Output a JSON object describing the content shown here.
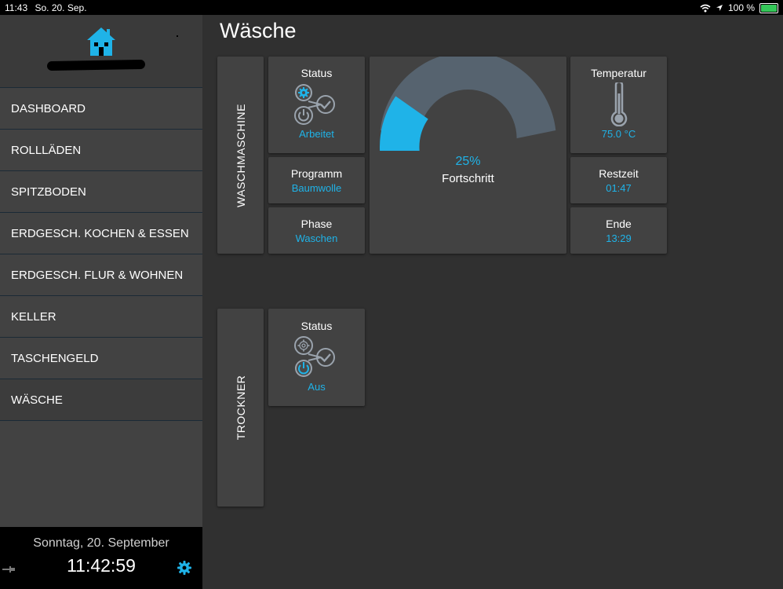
{
  "statusbar": {
    "time": "11:43",
    "date": "So. 20. Sep.",
    "battery": "100 %"
  },
  "sidebar": {
    "items": [
      {
        "label": "DASHBOARD"
      },
      {
        "label": "ROLLLÄDEN"
      },
      {
        "label": "SPITZBODEN"
      },
      {
        "label": "ERDGESCH. KOCHEN & ESSEN"
      },
      {
        "label": "ERDGESCH. FLUR & WOHNEN"
      },
      {
        "label": "KELLER"
      },
      {
        "label": "TASCHENGELD"
      },
      {
        "label": "WÄSCHE"
      }
    ],
    "active_index": 7,
    "footer": {
      "date": "Sonntag, 20. September",
      "time": "11:42:59"
    }
  },
  "page": {
    "title": "Wäsche"
  },
  "washer": {
    "group_label": "WASCHMASCHINE",
    "status": {
      "title": "Status",
      "value": "Arbeitet"
    },
    "program": {
      "title": "Programm",
      "value": "Baumwolle"
    },
    "phase": {
      "title": "Phase",
      "value": "Waschen"
    },
    "progress": {
      "percent_label": "25%",
      "label": "Fortschritt",
      "value": 0.25
    },
    "temperature": {
      "title": "Temperatur",
      "value": "75.0 °C"
    },
    "remaining": {
      "title": "Restzeit",
      "value": "01:47"
    },
    "end": {
      "title": "Ende",
      "value": "13:29"
    }
  },
  "dryer": {
    "group_label": "TROCKNER",
    "status": {
      "title": "Status",
      "value": "Aus"
    }
  },
  "colors": {
    "accent": "#1fb3e8",
    "card": "#424242",
    "background": "#303030",
    "gauge_track": "#56636f",
    "icon_gray": "#9aa3ad"
  },
  "icons": [
    "house-icon",
    "gear-icon",
    "power-icon",
    "check-icon",
    "thermometer-icon",
    "pin-icon",
    "wifi-icon",
    "location-icon",
    "battery-icon"
  ]
}
